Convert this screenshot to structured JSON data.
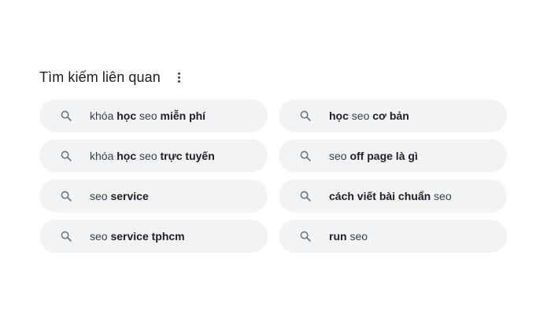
{
  "section": {
    "title": "Tìm kiếm liên quan",
    "more_icon": "more-vert-icon"
  },
  "search_icon": "search-icon",
  "colors": {
    "chip_bg": "#f1f3f4",
    "text": "#3c4043",
    "title": "#202124"
  },
  "chips": [
    {
      "parts": [
        {
          "t": "khóa ",
          "b": false
        },
        {
          "t": "học",
          "b": true
        },
        {
          "t": " seo ",
          "b": false
        },
        {
          "t": "miễn phí",
          "b": true
        }
      ]
    },
    {
      "parts": [
        {
          "t": "học",
          "b": true
        },
        {
          "t": " seo ",
          "b": false
        },
        {
          "t": "cơ bản",
          "b": true
        }
      ]
    },
    {
      "parts": [
        {
          "t": "khóa ",
          "b": false
        },
        {
          "t": "học",
          "b": true
        },
        {
          "t": " seo ",
          "b": false
        },
        {
          "t": "trực tuyến",
          "b": true
        }
      ]
    },
    {
      "parts": [
        {
          "t": "seo ",
          "b": false
        },
        {
          "t": "off page là gì",
          "b": true
        }
      ]
    },
    {
      "parts": [
        {
          "t": "seo ",
          "b": false
        },
        {
          "t": "service",
          "b": true
        }
      ]
    },
    {
      "parts": [
        {
          "t": "cách viết bài chuẩn",
          "b": true
        },
        {
          "t": " seo",
          "b": false
        }
      ]
    },
    {
      "parts": [
        {
          "t": "seo ",
          "b": false
        },
        {
          "t": "service tphcm",
          "b": true
        }
      ]
    },
    {
      "parts": [
        {
          "t": "run",
          "b": true
        },
        {
          "t": " seo",
          "b": false
        }
      ]
    }
  ]
}
